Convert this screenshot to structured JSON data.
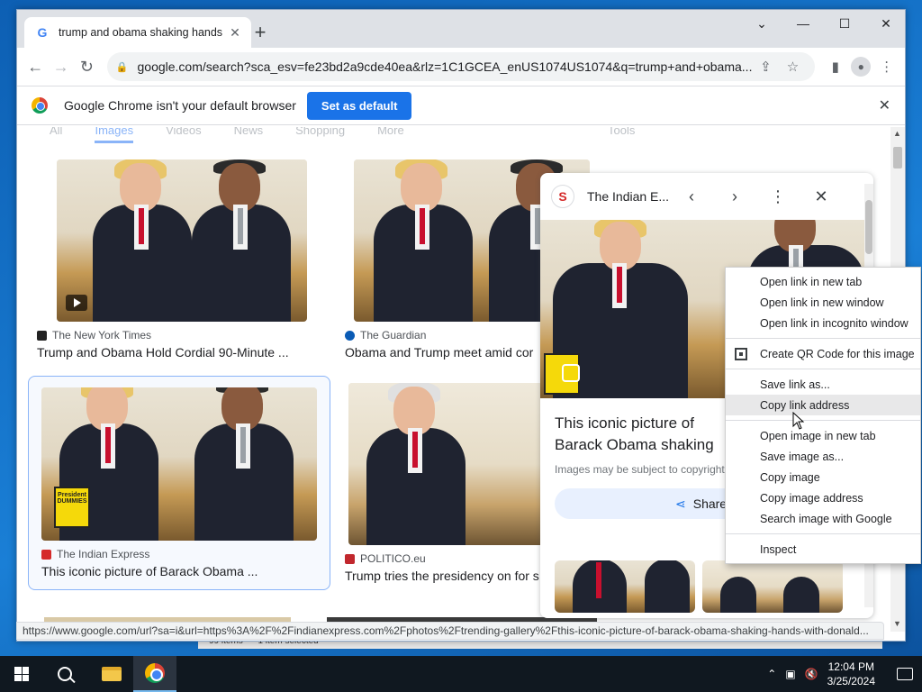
{
  "browser": {
    "tab_title": "trump and obama shaking hands",
    "tab_close": "✕",
    "new_tab": "+",
    "url": "google.com/search?sca_esv=fe23bd2a9cde40ea&rlz=1C1GCEA_enUS1074US1074&q=trump+and+obama...",
    "window_controls": {
      "dropdown": "⌄",
      "minimize": "—",
      "maximize": "☐",
      "close": "✕"
    }
  },
  "infobar": {
    "message": "Google Chrome isn't your default browser",
    "button": "Set as default",
    "close": "✕"
  },
  "search_tabs": {
    "items": [
      "All",
      "Images",
      "Videos",
      "News",
      "Shopping",
      "More"
    ],
    "tools": "Tools"
  },
  "results": [
    {
      "source": "The New York Times",
      "title": "Trump and Obama Hold Cordial 90-Minute ..."
    },
    {
      "source": "The Guardian",
      "title": "Obama and Trump meet amid cor"
    },
    {
      "source": "The Indian Express",
      "title": "This iconic picture of Barack Obama ..."
    },
    {
      "source": "POLITICO.eu",
      "title": "Trump tries the presidency on for s"
    }
  ],
  "book_label": "President DUMMIES",
  "panel": {
    "logo": "S",
    "source": "The Indian E...",
    "title_line1": "This iconic picture of",
    "title_line2": "Barack Obama shaking",
    "copyright": "Images may be subject to copyright.",
    "share": "Share"
  },
  "context_menu": {
    "group1": [
      "Open link in new tab",
      "Open link in new window",
      "Open link in incognito window"
    ],
    "qr": "Create QR Code for this image",
    "group2": [
      "Save link as...",
      "Copy link address"
    ],
    "group3": [
      "Open image in new tab",
      "Save image as...",
      "Copy image",
      "Copy image address",
      "Search image with Google"
    ],
    "inspect": "Inspect"
  },
  "status_url": "https://www.google.com/url?sa=i&url=https%3A%2F%2Findianexpress.com%2Fphotos%2Ftrending-gallery%2Fthis-iconic-picture-of-barack-obama-shaking-hands-with-donald...",
  "behind_window": {
    "items": "99 items",
    "selected": "1 item selected"
  },
  "taskbar": {
    "time": "12:04 PM",
    "date": "3/25/2024"
  }
}
